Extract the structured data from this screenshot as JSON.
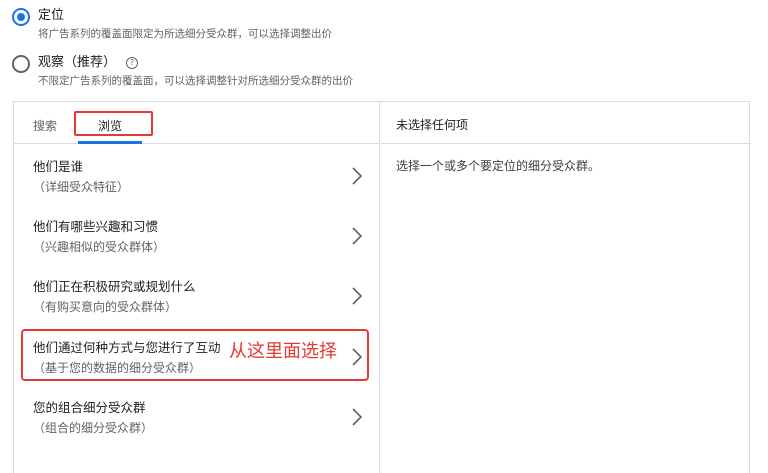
{
  "targeting_options": [
    {
      "title": "定位",
      "description": "将广告系列的覆盖面限定为所选细分受众群，可以选择调整出价",
      "selected": true
    },
    {
      "title": "观察（推荐）",
      "description": "不限定广告系列的覆盖面，可以选择调整针对所选细分受众群的出价",
      "selected": false
    }
  ],
  "help_icon_glyph": "?",
  "tabs": [
    {
      "label": "搜索",
      "active": false
    },
    {
      "label": "浏览",
      "active": true
    }
  ],
  "browse_items": [
    {
      "title": "他们是谁",
      "subtitle": "（详细受众特征）"
    },
    {
      "title": "他们有哪些兴趣和习惯",
      "subtitle": "（兴趣相似的受众群体）"
    },
    {
      "title": "他们正在积极研究或规划什么",
      "subtitle": "（有购买意向的受众群体）"
    },
    {
      "title": "他们通过何种方式与您进行了互动",
      "subtitle": "（基于您的数据的细分受众群）"
    },
    {
      "title": "您的组合细分受众群",
      "subtitle": "（组合的细分受众群）"
    }
  ],
  "annotation": "从这里面选择",
  "selection_panel": {
    "title": "未选择任何项",
    "empty_message": "选择一个或多个要定位的细分受众群。"
  },
  "colors": {
    "accent": "#1a73e8",
    "annotation": "#e53935",
    "border": "#dadce0"
  }
}
